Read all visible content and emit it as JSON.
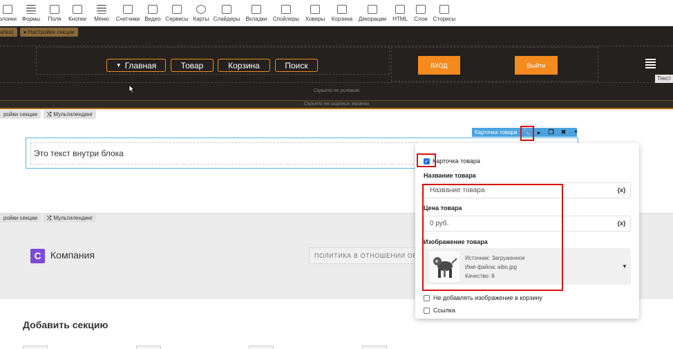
{
  "toolbar": {
    "items": [
      {
        "label": "олонки",
        "icon": "columns-icon"
      },
      {
        "label": "Формы",
        "icon": "forms-icon"
      },
      {
        "label": "Поля",
        "icon": "fields-icon"
      },
      {
        "label": "Кнопки",
        "icon": "buttons-icon"
      },
      {
        "label": "Меню",
        "icon": "menu-icon"
      },
      {
        "label": "Счетчики",
        "icon": "counters-icon"
      },
      {
        "label": "Видео",
        "icon": "video-icon"
      },
      {
        "label": "Сервисы",
        "icon": "services-icon"
      },
      {
        "label": "Карты",
        "icon": "map-pin-icon"
      },
      {
        "label": "Слайдеры",
        "icon": "sliders-icon"
      },
      {
        "label": "Вкладки",
        "icon": "tabs-icon"
      },
      {
        "label": "Спойлеры",
        "icon": "spoilers-icon"
      },
      {
        "label": "Ховеры",
        "icon": "hover-icon"
      },
      {
        "label": "Корзина",
        "icon": "cart-icon"
      },
      {
        "label": "Декорации",
        "icon": "decorations-icon"
      },
      {
        "label": "HTML",
        "icon": "code-icon"
      },
      {
        "label": "Слои",
        "icon": "layers-icon"
      },
      {
        "label": "Сторисы",
        "icon": "stories-icon"
      }
    ]
  },
  "header_section": {
    "tag_left": "апка)",
    "tag_settings": "Настройки секции",
    "nav": [
      "Главная",
      "Товар",
      "Корзина",
      "Поиск"
    ],
    "login": "ВХОД",
    "logout": "Выйти",
    "text_tab": "Текст",
    "hidden_condition": "Скрыто по условию",
    "hidden_wide": "Скрыто на широких экранах"
  },
  "section_tags": {
    "settings": "ройки секции",
    "multilanding": "Мультилендинг"
  },
  "text_block": {
    "content": "Это текст внутри блока"
  },
  "card_bar": {
    "label": "Карточка товара"
  },
  "panel": {
    "checkbox_label": "Карточка товара",
    "name_label": "Название товара",
    "name_placeholder": "Название товара",
    "price_label": "Цена товара",
    "price_placeholder": "0 руб.",
    "var_button": "{x}",
    "image_label": "Изображение товара",
    "image_source": "Источник: Загруженное",
    "image_file": "Имя файла: aibo.jpg",
    "image_quality": "Качество: 8",
    "no_cart_image": "Не добавлять изображение в корзину",
    "link": "Ссылка"
  },
  "footer_section": {
    "logo_letter": "C",
    "company": "Компания",
    "policy": "ПОЛИТИКА В ОТНОШЕНИИ ОБ"
  },
  "add_section": "Добавить секцию",
  "colors": {
    "dark_bg": "#24211f",
    "accent_orange": "#f58a1f",
    "accent_blue": "#4aa3df",
    "highlight_red": "#d81010",
    "logo_purple": "#7b4bd6"
  }
}
